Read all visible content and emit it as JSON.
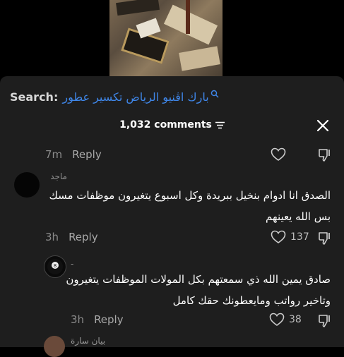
{
  "search": {
    "label": "Search:",
    "query": "بارك اڤنيو الرياض تكسير عطور"
  },
  "comments_panel": {
    "count": "1,032 comments"
  },
  "top_comment_meta": {
    "time": "7m",
    "reply": "Reply"
  },
  "comment1": {
    "username": "ماجد",
    "line1": "الصدق انا ادوام بنخيل ببريدة وكل اسبوع يتغيرون موظفات مسك",
    "line2": "بس الله يعينهم",
    "time": "3h",
    "reply": "Reply",
    "likes": "137"
  },
  "comment2": {
    "username": "-",
    "line1": "صادق يمين الله ذي سمعتهم بكل المولات الموظفات يتغيرون",
    "line2": "وتاخير رواتب ومايعطونك حقك كامل",
    "time": "3h",
    "reply": "Reply",
    "likes": "38"
  },
  "comment3": {
    "username": "بيان سارة"
  }
}
